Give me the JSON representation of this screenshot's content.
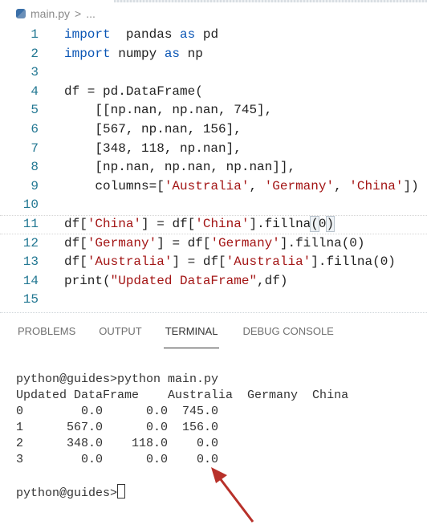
{
  "breadcrumb": {
    "file": "main.py",
    "sep": ">",
    "more": "..."
  },
  "editor": {
    "current_line": 11,
    "lines": [
      {
        "n": "1",
        "tokens": [
          [
            "kw",
            "import"
          ],
          [
            "",
            "  pandas "
          ],
          [
            "kw",
            "as"
          ],
          [
            "",
            " pd"
          ]
        ]
      },
      {
        "n": "2",
        "tokens": [
          [
            "kw",
            "import"
          ],
          [
            "",
            " numpy "
          ],
          [
            "kw",
            "as"
          ],
          [
            "",
            " np"
          ]
        ]
      },
      {
        "n": "3",
        "tokens": []
      },
      {
        "n": "4",
        "tokens": [
          [
            "",
            "df = pd.DataFrame("
          ]
        ]
      },
      {
        "n": "5",
        "tokens": [
          [
            "",
            "    [[np.nan, np.nan, 745],"
          ]
        ]
      },
      {
        "n": "6",
        "tokens": [
          [
            "",
            "    [567, np.nan, 156],"
          ]
        ]
      },
      {
        "n": "7",
        "tokens": [
          [
            "",
            "    [348, 118, np.nan],"
          ]
        ]
      },
      {
        "n": "8",
        "tokens": [
          [
            "",
            "    [np.nan, np.nan, np.nan]],"
          ]
        ]
      },
      {
        "n": "9",
        "tokens": [
          [
            "",
            "    columns=["
          ],
          [
            "str",
            "'Australia'"
          ],
          [
            "",
            ", "
          ],
          [
            "str",
            "'Germany'"
          ],
          [
            "",
            ", "
          ],
          [
            "str",
            "'China'"
          ],
          [
            "",
            "])"
          ]
        ]
      },
      {
        "n": "10",
        "tokens": []
      },
      {
        "n": "11",
        "tokens": [
          [
            "",
            "df["
          ],
          [
            "str",
            "'China'"
          ],
          [
            "",
            "] = df["
          ],
          [
            "str",
            "'China'"
          ],
          [
            "",
            "].fillna"
          ],
          [
            "br",
            "("
          ],
          [
            "",
            "0"
          ],
          [
            "br",
            ")"
          ]
        ]
      },
      {
        "n": "12",
        "tokens": [
          [
            "",
            "df["
          ],
          [
            "str",
            "'Germany'"
          ],
          [
            "",
            "] = df["
          ],
          [
            "str",
            "'Germany'"
          ],
          [
            "",
            "].fillna(0)"
          ]
        ]
      },
      {
        "n": "13",
        "tokens": [
          [
            "",
            "df["
          ],
          [
            "str",
            "'Australia'"
          ],
          [
            "",
            "] = df["
          ],
          [
            "str",
            "'Australia'"
          ],
          [
            "",
            "].fillna(0)"
          ]
        ]
      },
      {
        "n": "14",
        "tokens": [
          [
            "",
            "print("
          ],
          [
            "str",
            "\"Updated DataFrame\""
          ],
          [
            "",
            ",df)"
          ]
        ]
      },
      {
        "n": "15",
        "tokens": []
      }
    ]
  },
  "panel": {
    "tabs": [
      "PROBLEMS",
      "OUTPUT",
      "TERMINAL",
      "DEBUG CONSOLE"
    ],
    "active": "TERMINAL"
  },
  "terminal": {
    "lines": [
      "python@guides>python main.py",
      "Updated DataFrame    Australia  Germany  China",
      "0        0.0      0.0  745.0",
      "1      567.0      0.0  156.0",
      "2      348.0    118.0    0.0",
      "3        0.0      0.0    0.0",
      ""
    ],
    "prompt": "python@guides>"
  },
  "colors": {
    "arrow": "#b8312a",
    "keyword": "#0b56b5",
    "string": "#a31515",
    "line_number": "#237893"
  }
}
